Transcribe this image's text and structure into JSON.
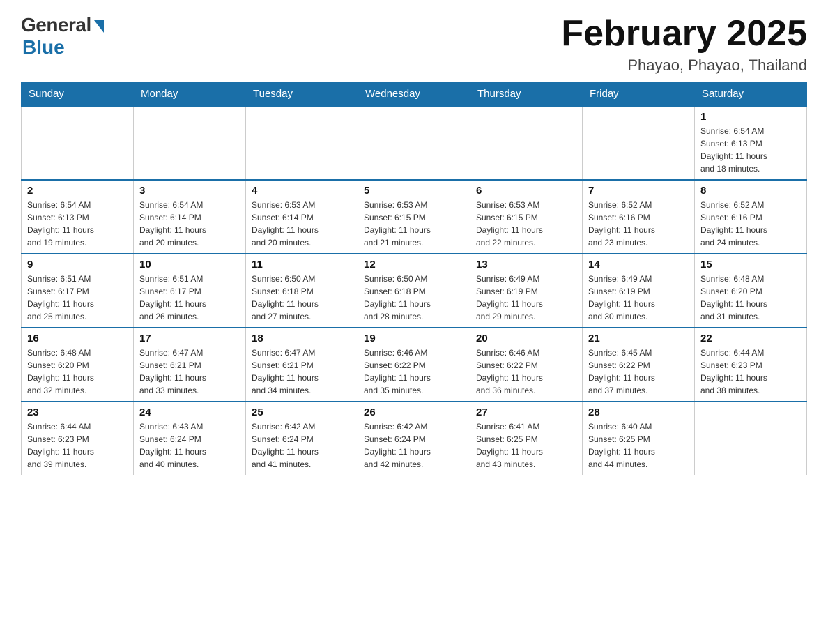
{
  "logo": {
    "general_text": "General",
    "blue_text": "Blue"
  },
  "header": {
    "month_year": "February 2025",
    "location": "Phayao, Phayao, Thailand"
  },
  "days_of_week": [
    "Sunday",
    "Monday",
    "Tuesday",
    "Wednesday",
    "Thursday",
    "Friday",
    "Saturday"
  ],
  "weeks": [
    {
      "days": [
        {
          "date": "",
          "info": ""
        },
        {
          "date": "",
          "info": ""
        },
        {
          "date": "",
          "info": ""
        },
        {
          "date": "",
          "info": ""
        },
        {
          "date": "",
          "info": ""
        },
        {
          "date": "",
          "info": ""
        },
        {
          "date": "1",
          "info": "Sunrise: 6:54 AM\nSunset: 6:13 PM\nDaylight: 11 hours\nand 18 minutes."
        }
      ]
    },
    {
      "days": [
        {
          "date": "2",
          "info": "Sunrise: 6:54 AM\nSunset: 6:13 PM\nDaylight: 11 hours\nand 19 minutes."
        },
        {
          "date": "3",
          "info": "Sunrise: 6:54 AM\nSunset: 6:14 PM\nDaylight: 11 hours\nand 20 minutes."
        },
        {
          "date": "4",
          "info": "Sunrise: 6:53 AM\nSunset: 6:14 PM\nDaylight: 11 hours\nand 20 minutes."
        },
        {
          "date": "5",
          "info": "Sunrise: 6:53 AM\nSunset: 6:15 PM\nDaylight: 11 hours\nand 21 minutes."
        },
        {
          "date": "6",
          "info": "Sunrise: 6:53 AM\nSunset: 6:15 PM\nDaylight: 11 hours\nand 22 minutes."
        },
        {
          "date": "7",
          "info": "Sunrise: 6:52 AM\nSunset: 6:16 PM\nDaylight: 11 hours\nand 23 minutes."
        },
        {
          "date": "8",
          "info": "Sunrise: 6:52 AM\nSunset: 6:16 PM\nDaylight: 11 hours\nand 24 minutes."
        }
      ]
    },
    {
      "days": [
        {
          "date": "9",
          "info": "Sunrise: 6:51 AM\nSunset: 6:17 PM\nDaylight: 11 hours\nand 25 minutes."
        },
        {
          "date": "10",
          "info": "Sunrise: 6:51 AM\nSunset: 6:17 PM\nDaylight: 11 hours\nand 26 minutes."
        },
        {
          "date": "11",
          "info": "Sunrise: 6:50 AM\nSunset: 6:18 PM\nDaylight: 11 hours\nand 27 minutes."
        },
        {
          "date": "12",
          "info": "Sunrise: 6:50 AM\nSunset: 6:18 PM\nDaylight: 11 hours\nand 28 minutes."
        },
        {
          "date": "13",
          "info": "Sunrise: 6:49 AM\nSunset: 6:19 PM\nDaylight: 11 hours\nand 29 minutes."
        },
        {
          "date": "14",
          "info": "Sunrise: 6:49 AM\nSunset: 6:19 PM\nDaylight: 11 hours\nand 30 minutes."
        },
        {
          "date": "15",
          "info": "Sunrise: 6:48 AM\nSunset: 6:20 PM\nDaylight: 11 hours\nand 31 minutes."
        }
      ]
    },
    {
      "days": [
        {
          "date": "16",
          "info": "Sunrise: 6:48 AM\nSunset: 6:20 PM\nDaylight: 11 hours\nand 32 minutes."
        },
        {
          "date": "17",
          "info": "Sunrise: 6:47 AM\nSunset: 6:21 PM\nDaylight: 11 hours\nand 33 minutes."
        },
        {
          "date": "18",
          "info": "Sunrise: 6:47 AM\nSunset: 6:21 PM\nDaylight: 11 hours\nand 34 minutes."
        },
        {
          "date": "19",
          "info": "Sunrise: 6:46 AM\nSunset: 6:22 PM\nDaylight: 11 hours\nand 35 minutes."
        },
        {
          "date": "20",
          "info": "Sunrise: 6:46 AM\nSunset: 6:22 PM\nDaylight: 11 hours\nand 36 minutes."
        },
        {
          "date": "21",
          "info": "Sunrise: 6:45 AM\nSunset: 6:22 PM\nDaylight: 11 hours\nand 37 minutes."
        },
        {
          "date": "22",
          "info": "Sunrise: 6:44 AM\nSunset: 6:23 PM\nDaylight: 11 hours\nand 38 minutes."
        }
      ]
    },
    {
      "days": [
        {
          "date": "23",
          "info": "Sunrise: 6:44 AM\nSunset: 6:23 PM\nDaylight: 11 hours\nand 39 minutes."
        },
        {
          "date": "24",
          "info": "Sunrise: 6:43 AM\nSunset: 6:24 PM\nDaylight: 11 hours\nand 40 minutes."
        },
        {
          "date": "25",
          "info": "Sunrise: 6:42 AM\nSunset: 6:24 PM\nDaylight: 11 hours\nand 41 minutes."
        },
        {
          "date": "26",
          "info": "Sunrise: 6:42 AM\nSunset: 6:24 PM\nDaylight: 11 hours\nand 42 minutes."
        },
        {
          "date": "27",
          "info": "Sunrise: 6:41 AM\nSunset: 6:25 PM\nDaylight: 11 hours\nand 43 minutes."
        },
        {
          "date": "28",
          "info": "Sunrise: 6:40 AM\nSunset: 6:25 PM\nDaylight: 11 hours\nand 44 minutes."
        },
        {
          "date": "",
          "info": ""
        }
      ]
    }
  ]
}
